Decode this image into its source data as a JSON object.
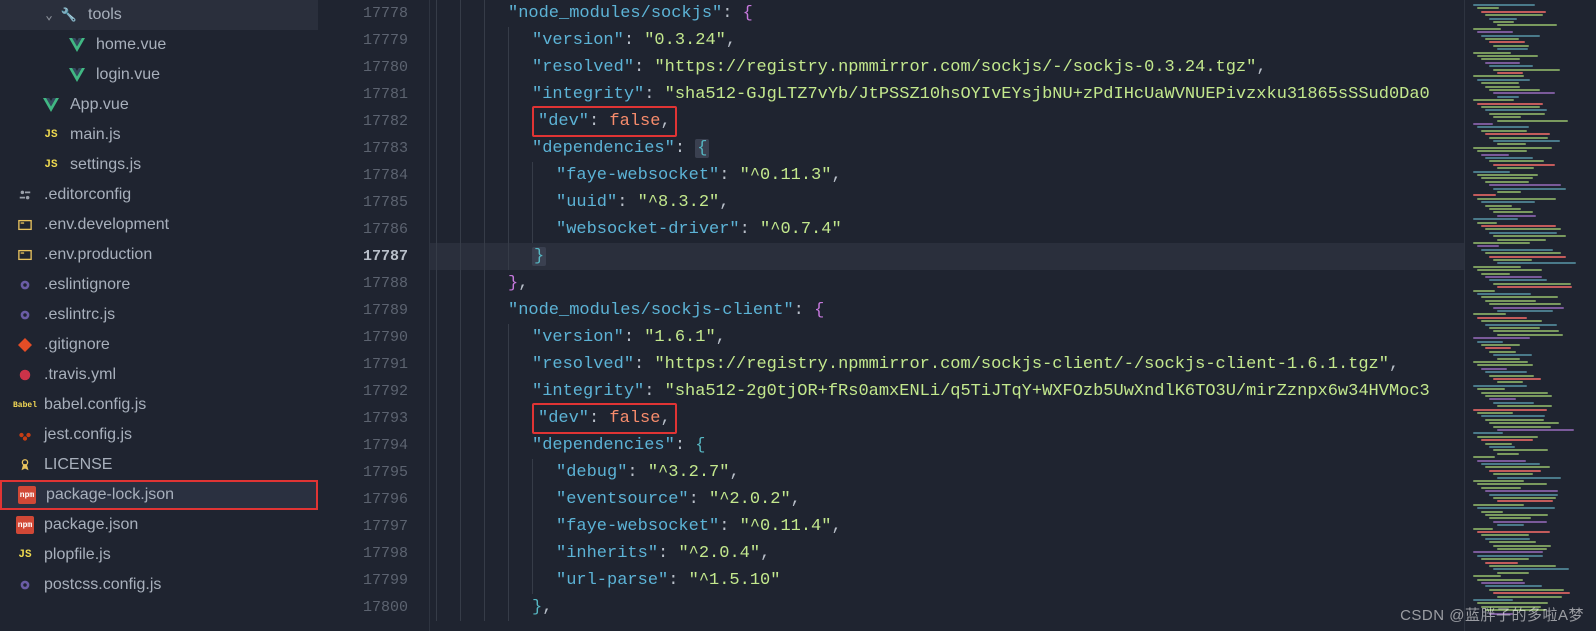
{
  "sidebar": {
    "items": [
      {
        "icon": "chevron",
        "label": "tools",
        "indent": 1,
        "type": "folder"
      },
      {
        "icon": "vue",
        "label": "home.vue",
        "indent": 2
      },
      {
        "icon": "vue",
        "label": "login.vue",
        "indent": 2
      },
      {
        "icon": "vue",
        "label": "App.vue",
        "indent": 1
      },
      {
        "icon": "js",
        "label": "main.js",
        "indent": 1
      },
      {
        "icon": "js",
        "label": "settings.js",
        "indent": 1
      },
      {
        "icon": "cfg",
        "label": ".editorconfig",
        "indent": 0
      },
      {
        "icon": "env",
        "label": ".env.development",
        "indent": 0
      },
      {
        "icon": "env",
        "label": ".env.production",
        "indent": 0
      },
      {
        "icon": "gear",
        "label": ".eslintignore",
        "indent": 0
      },
      {
        "icon": "gear",
        "label": ".eslintrc.js",
        "indent": 0
      },
      {
        "icon": "git",
        "label": ".gitignore",
        "indent": 0
      },
      {
        "icon": "travis",
        "label": ".travis.yml",
        "indent": 0
      },
      {
        "icon": "babel",
        "label": "babel.config.js",
        "indent": 0
      },
      {
        "icon": "jest",
        "label": "jest.config.js",
        "indent": 0
      },
      {
        "icon": "lic",
        "label": "LICENSE",
        "indent": 0
      },
      {
        "icon": "json",
        "label": "package-lock.json",
        "indent": 0,
        "active": true
      },
      {
        "icon": "json",
        "label": "package.json",
        "indent": 0
      },
      {
        "icon": "js",
        "label": "plopfile.js",
        "indent": 0
      },
      {
        "icon": "gear",
        "label": "postcss.config.js",
        "indent": 0
      }
    ]
  },
  "gutter": {
    "start": 17778,
    "end": 17800,
    "current": 17787
  },
  "code": {
    "lines": [
      {
        "n": 17778,
        "seg": [
          {
            "ind": 3
          },
          {
            "t": "\"node_modules/sockjs\"",
            "c": "key"
          },
          {
            "t": ": ",
            "c": "punc"
          },
          {
            "t": "{",
            "c": "brace"
          }
        ]
      },
      {
        "n": 17779,
        "seg": [
          {
            "ind": 4
          },
          {
            "t": "\"version\"",
            "c": "key"
          },
          {
            "t": ": ",
            "c": "punc"
          },
          {
            "t": "\"0.3.24\"",
            "c": "str"
          },
          {
            "t": ",",
            "c": "punc"
          }
        ]
      },
      {
        "n": 17780,
        "seg": [
          {
            "ind": 4
          },
          {
            "t": "\"resolved\"",
            "c": "key"
          },
          {
            "t": ": ",
            "c": "punc"
          },
          {
            "t": "\"https://registry.npmmirror.com/sockjs/-/sockjs-0.3.24.tgz\"",
            "c": "str"
          },
          {
            "t": ",",
            "c": "punc"
          }
        ]
      },
      {
        "n": 17781,
        "seg": [
          {
            "ind": 4
          },
          {
            "t": "\"integrity\"",
            "c": "key"
          },
          {
            "t": ": ",
            "c": "punc"
          },
          {
            "t": "\"sha512-GJgLTZ7vYb/JtPSSZ10hsOYIvEYsjbNU+zPdIHcUaWVNUEPivzxku31865sSSud0Da0",
            "c": "str"
          }
        ]
      },
      {
        "n": 17782,
        "seg": [
          {
            "ind": 4
          },
          {
            "box": true,
            "inner": [
              {
                "t": "\"dev\"",
                "c": "key"
              },
              {
                "t": ": ",
                "c": "punc"
              },
              {
                "t": "false",
                "c": "bool"
              },
              {
                "t": ",",
                "c": "punc"
              }
            ]
          }
        ]
      },
      {
        "n": 17783,
        "seg": [
          {
            "ind": 4
          },
          {
            "t": "\"dependencies\"",
            "c": "key"
          },
          {
            "t": ": ",
            "c": "punc"
          },
          {
            "t": "{",
            "c": "brace2",
            "sel": true
          }
        ]
      },
      {
        "n": 17784,
        "seg": [
          {
            "ind": 5
          },
          {
            "t": "\"faye-websocket\"",
            "c": "key"
          },
          {
            "t": ": ",
            "c": "punc"
          },
          {
            "t": "\"^0.11.3\"",
            "c": "str"
          },
          {
            "t": ",",
            "c": "punc"
          }
        ]
      },
      {
        "n": 17785,
        "seg": [
          {
            "ind": 5
          },
          {
            "t": "\"uuid\"",
            "c": "key"
          },
          {
            "t": ": ",
            "c": "punc"
          },
          {
            "t": "\"^8.3.2\"",
            "c": "str"
          },
          {
            "t": ",",
            "c": "punc"
          }
        ]
      },
      {
        "n": 17786,
        "seg": [
          {
            "ind": 5
          },
          {
            "t": "\"websocket-driver\"",
            "c": "key"
          },
          {
            "t": ": ",
            "c": "punc"
          },
          {
            "t": "\"^0.7.4\"",
            "c": "str"
          }
        ]
      },
      {
        "n": 17787,
        "seg": [
          {
            "ind": 4
          },
          {
            "t": "}",
            "c": "brace2",
            "sel": true
          }
        ],
        "current": true
      },
      {
        "n": 17788,
        "seg": [
          {
            "ind": 3
          },
          {
            "t": "}",
            "c": "brace"
          },
          {
            "t": ",",
            "c": "punc"
          }
        ]
      },
      {
        "n": 17789,
        "seg": [
          {
            "ind": 3
          },
          {
            "t": "\"node_modules/sockjs-client\"",
            "c": "key"
          },
          {
            "t": ": ",
            "c": "punc"
          },
          {
            "t": "{",
            "c": "brace"
          }
        ]
      },
      {
        "n": 17790,
        "seg": [
          {
            "ind": 4
          },
          {
            "t": "\"version\"",
            "c": "key"
          },
          {
            "t": ": ",
            "c": "punc"
          },
          {
            "t": "\"1.6.1\"",
            "c": "str"
          },
          {
            "t": ",",
            "c": "punc"
          }
        ]
      },
      {
        "n": 17791,
        "seg": [
          {
            "ind": 4
          },
          {
            "t": "\"resolved\"",
            "c": "key"
          },
          {
            "t": ": ",
            "c": "punc"
          },
          {
            "t": "\"https://registry.npmmirror.com/sockjs-client/-/sockjs-client-1.6.1.tgz\"",
            "c": "str"
          },
          {
            "t": ",",
            "c": "punc"
          }
        ]
      },
      {
        "n": 17792,
        "seg": [
          {
            "ind": 4
          },
          {
            "t": "\"integrity\"",
            "c": "key"
          },
          {
            "t": ": ",
            "c": "punc"
          },
          {
            "t": "\"sha512-2g0tjOR+fRs0amxENLi/q5TiJTqY+WXFOzb5UwXndlK6TO3U/mirZznpx6w34HVMoc3",
            "c": "str"
          }
        ]
      },
      {
        "n": 17793,
        "seg": [
          {
            "ind": 4
          },
          {
            "box": true,
            "inner": [
              {
                "t": "\"dev\"",
                "c": "key"
              },
              {
                "t": ": ",
                "c": "punc"
              },
              {
                "t": "false",
                "c": "bool"
              },
              {
                "t": ",",
                "c": "punc"
              }
            ]
          }
        ]
      },
      {
        "n": 17794,
        "seg": [
          {
            "ind": 4
          },
          {
            "t": "\"dependencies\"",
            "c": "key"
          },
          {
            "t": ": ",
            "c": "punc"
          },
          {
            "t": "{",
            "c": "brace2"
          }
        ]
      },
      {
        "n": 17795,
        "seg": [
          {
            "ind": 5
          },
          {
            "t": "\"debug\"",
            "c": "key"
          },
          {
            "t": ": ",
            "c": "punc"
          },
          {
            "t": "\"^3.2.7\"",
            "c": "str"
          },
          {
            "t": ",",
            "c": "punc"
          }
        ]
      },
      {
        "n": 17796,
        "seg": [
          {
            "ind": 5
          },
          {
            "t": "\"eventsource\"",
            "c": "key"
          },
          {
            "t": ": ",
            "c": "punc"
          },
          {
            "t": "\"^2.0.2\"",
            "c": "str"
          },
          {
            "t": ",",
            "c": "punc"
          }
        ]
      },
      {
        "n": 17797,
        "seg": [
          {
            "ind": 5
          },
          {
            "t": "\"faye-websocket\"",
            "c": "key"
          },
          {
            "t": ": ",
            "c": "punc"
          },
          {
            "t": "\"^0.11.4\"",
            "c": "str"
          },
          {
            "t": ",",
            "c": "punc"
          }
        ]
      },
      {
        "n": 17798,
        "seg": [
          {
            "ind": 5
          },
          {
            "t": "\"inherits\"",
            "c": "key"
          },
          {
            "t": ": ",
            "c": "punc"
          },
          {
            "t": "\"^2.0.4\"",
            "c": "str"
          },
          {
            "t": ",",
            "c": "punc"
          }
        ]
      },
      {
        "n": 17799,
        "seg": [
          {
            "ind": 5
          },
          {
            "t": "\"url-parse\"",
            "c": "key"
          },
          {
            "t": ": ",
            "c": "punc"
          },
          {
            "t": "\"^1.5.10\"",
            "c": "str"
          }
        ]
      },
      {
        "n": 17800,
        "seg": [
          {
            "ind": 4
          },
          {
            "t": "}",
            "c": "brace2"
          },
          {
            "t": ",",
            "c": "punc"
          }
        ]
      }
    ]
  },
  "watermark": "CSDN @蓝胖子的多啦A梦"
}
